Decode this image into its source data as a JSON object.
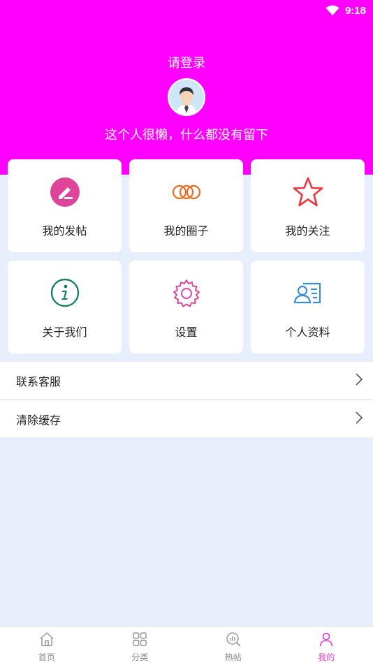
{
  "status_bar": {
    "time": "9:18"
  },
  "profile": {
    "login_prompt": "请登录",
    "bio": "这个人很懒，什么都没有留下"
  },
  "grid": [
    {
      "label": "我的发帖",
      "icon": "edit-icon"
    },
    {
      "label": "我的圈子",
      "icon": "circles-icon"
    },
    {
      "label": "我的关注",
      "icon": "star-icon"
    },
    {
      "label": "关于我们",
      "icon": "info-icon"
    },
    {
      "label": "设置",
      "icon": "gear-icon"
    },
    {
      "label": "个人资料",
      "icon": "profile-card-icon"
    }
  ],
  "list": [
    {
      "label": "联系客服"
    },
    {
      "label": "清除缓存"
    }
  ],
  "tabbar": [
    {
      "label": "首页",
      "icon": "home-icon"
    },
    {
      "label": "分类",
      "icon": "category-icon"
    },
    {
      "label": "热帖",
      "icon": "hot-posts-icon"
    },
    {
      "label": "我的",
      "icon": "user-icon",
      "active": true
    }
  ],
  "colors": {
    "header": "#ff00ff",
    "background": "#e8effc",
    "active_tab": "#e03cd0"
  }
}
